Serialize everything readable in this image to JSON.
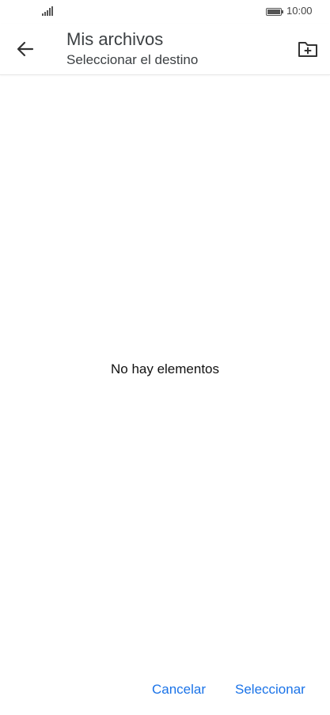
{
  "status_bar": {
    "time": "10:00",
    "signal_icon": "signal-bars-icon",
    "battery_icon": "battery-icon"
  },
  "app_bar": {
    "title": "Mis archivos",
    "subtitle": "Seleccionar el destino",
    "back_icon": "arrow-back-icon",
    "new_folder_icon": "create-new-folder-icon"
  },
  "main": {
    "empty_message": "No hay elementos"
  },
  "footer": {
    "cancel_label": "Cancelar",
    "select_label": "Seleccionar",
    "accent_color": "#1a73e8"
  }
}
